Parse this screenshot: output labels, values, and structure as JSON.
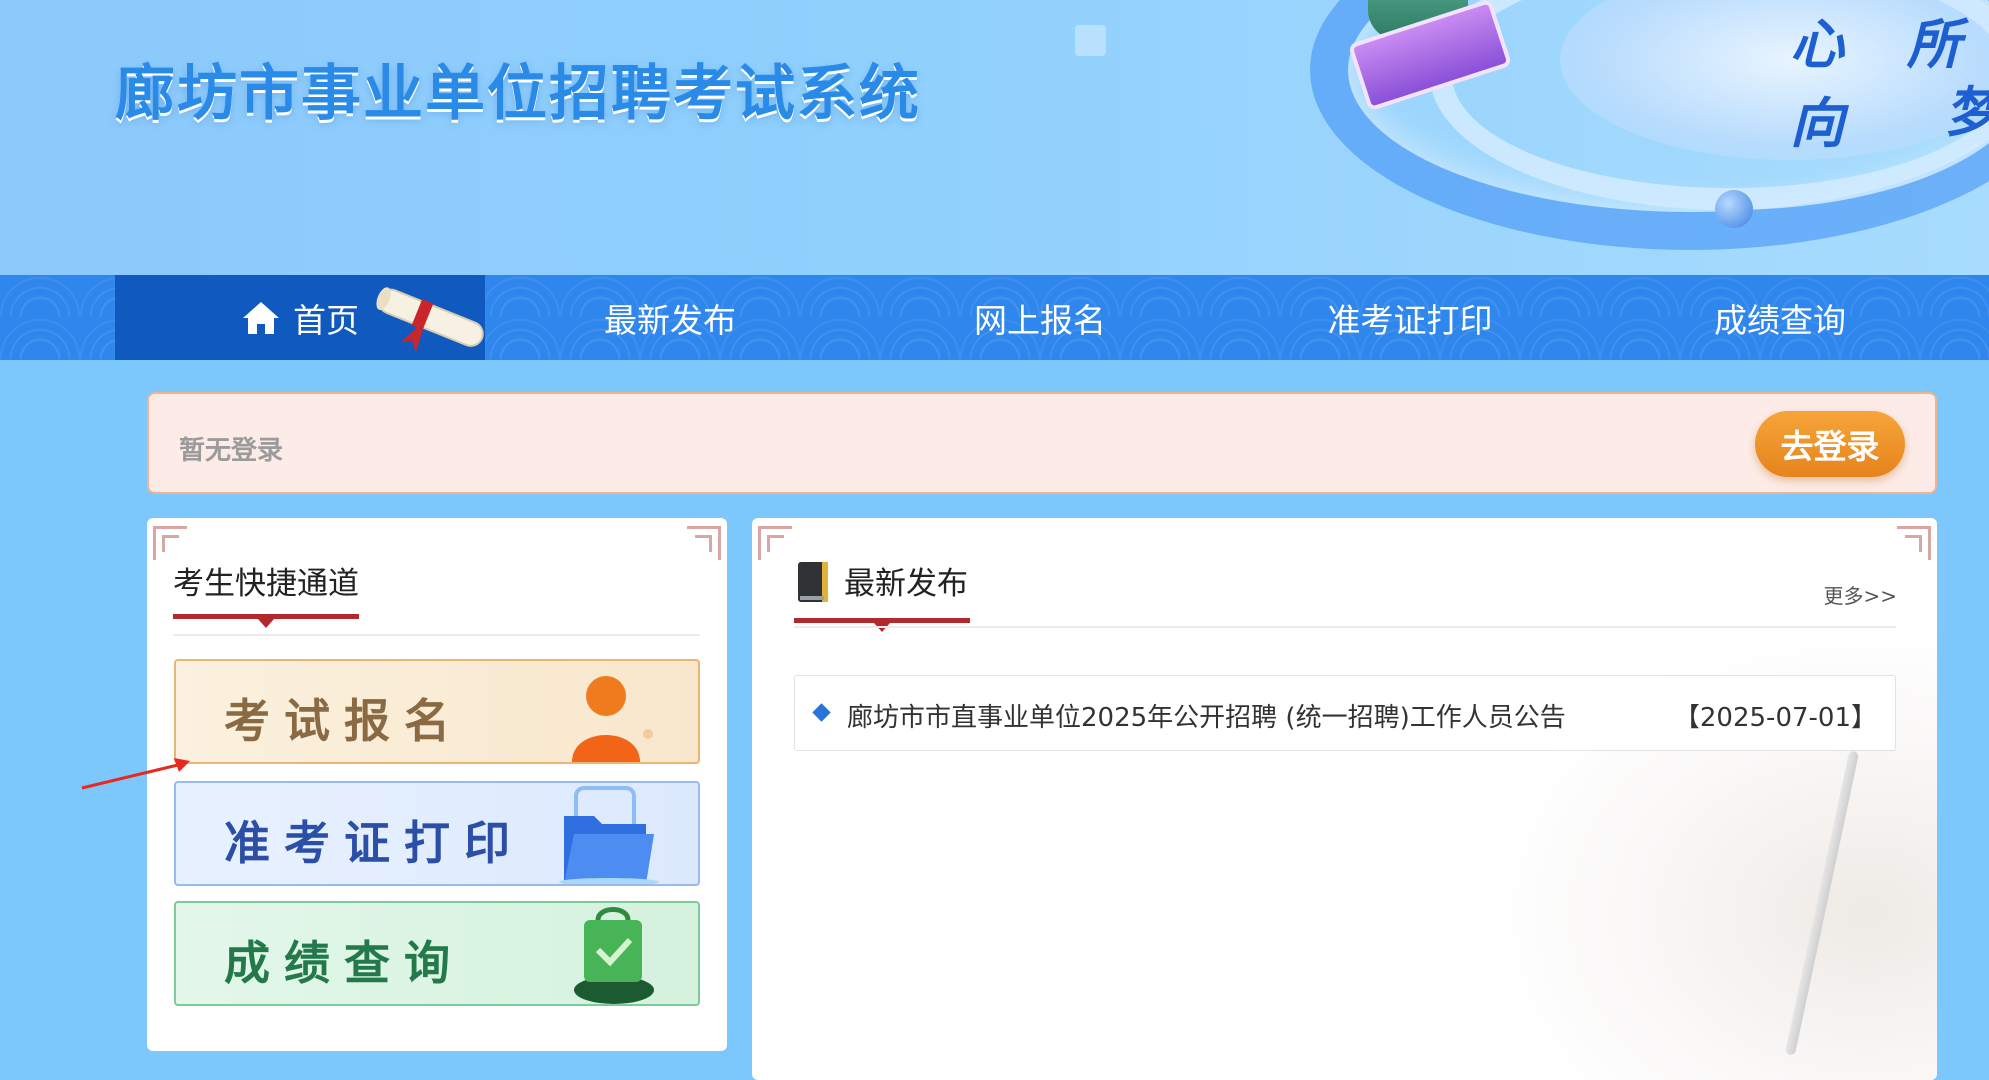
{
  "header": {
    "title": "廊坊市事业单位招聘考试系统",
    "slogan_line1": "心 所 向",
    "slogan_line2": "梦"
  },
  "nav": {
    "items": [
      {
        "label": "首页",
        "icon": "home-icon",
        "active": true
      },
      {
        "label": "最新发布"
      },
      {
        "label": "网上报名"
      },
      {
        "label": "准考证打印"
      },
      {
        "label": "成绩查询"
      }
    ]
  },
  "login": {
    "status": "暂无登录",
    "button": "去登录"
  },
  "quick_access": {
    "title": "考生快捷通道",
    "cards": [
      {
        "label": "考试报名",
        "icon": "person-icon"
      },
      {
        "label": "准考证打印",
        "icon": "folder-icon"
      },
      {
        "label": "成绩查询",
        "icon": "shopping-bag-icon"
      }
    ]
  },
  "latest": {
    "title": "最新发布",
    "more": "更多>>",
    "items": [
      {
        "title": "廊坊市市直事业单位2025年公开招聘 (统一招聘)工作人员公告",
        "date": "【2025-07-01】"
      }
    ]
  },
  "colors": {
    "nav_bg": "#2f86ec",
    "nav_active": "#1059bf",
    "heading_accent": "#b3282d",
    "login_button": "#e6831c"
  }
}
